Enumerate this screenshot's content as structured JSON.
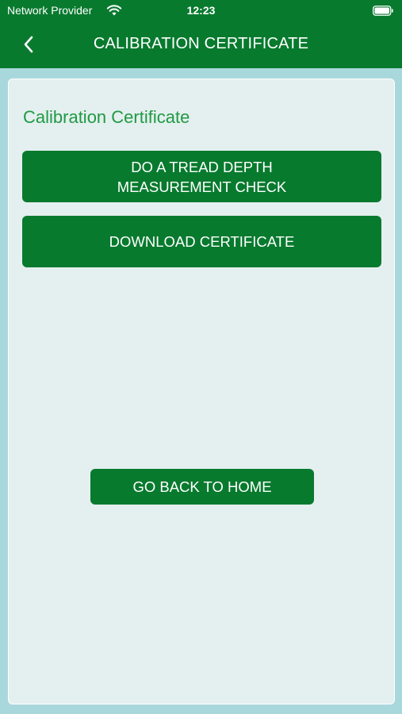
{
  "status_bar": {
    "carrier": "Network Provider",
    "time": "12:23",
    "wifi_icon": "wifi-icon",
    "battery_icon": "battery-icon"
  },
  "nav": {
    "back_icon": "chevron-left-icon",
    "title": "CALIBRATION CERTIFICATE"
  },
  "content": {
    "heading": "Calibration Certificate",
    "tread_check_label": "DO A TREAD DEPTH\nMEASUREMENT CHECK",
    "download_label": "DOWNLOAD CERTIFICATE",
    "home_label": "GO BACK TO HOME"
  },
  "colors": {
    "brand_green": "#087a2e",
    "heading_green": "#1f9a44",
    "card_background": "#e4efef",
    "page_background": "#a9d8dc"
  }
}
